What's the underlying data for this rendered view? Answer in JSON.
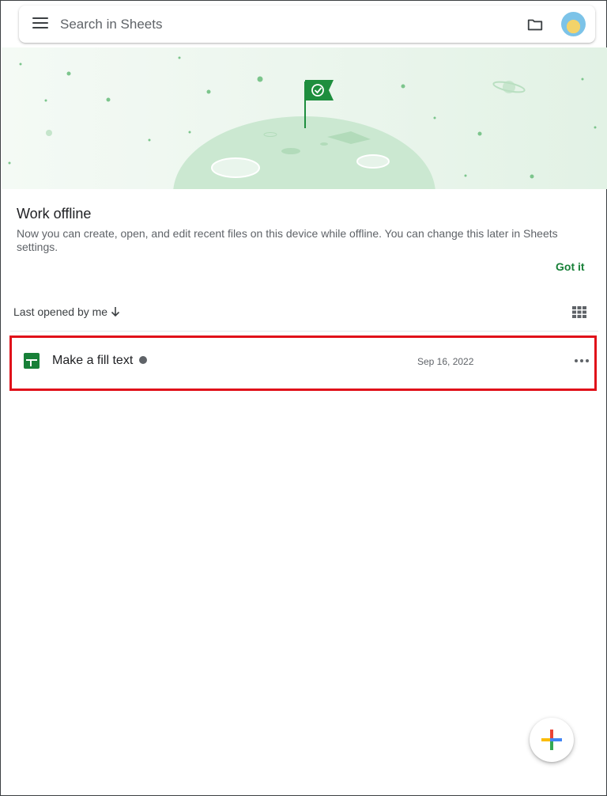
{
  "search": {
    "placeholder": "Search in Sheets"
  },
  "icons": {
    "menu": "menu-icon",
    "folder": "folder-icon",
    "avatar": "avatar",
    "grid": "grid-view-icon",
    "more": "more-options-icon",
    "add": "plus-icon",
    "sheets": "sheets-file-icon"
  },
  "offline_card": {
    "title": "Work offline",
    "description": "Now you can create, open, and edit recent files on this device while offline. You can change this later in Sheets settings.",
    "action": "Got it"
  },
  "list_header": {
    "sort_label": "Last opened by me"
  },
  "files": [
    {
      "name": "Make a fill text",
      "date": "Sep 16, 2022"
    }
  ],
  "colors": {
    "accent": "#188038",
    "highlight_border": "#e0111a"
  }
}
